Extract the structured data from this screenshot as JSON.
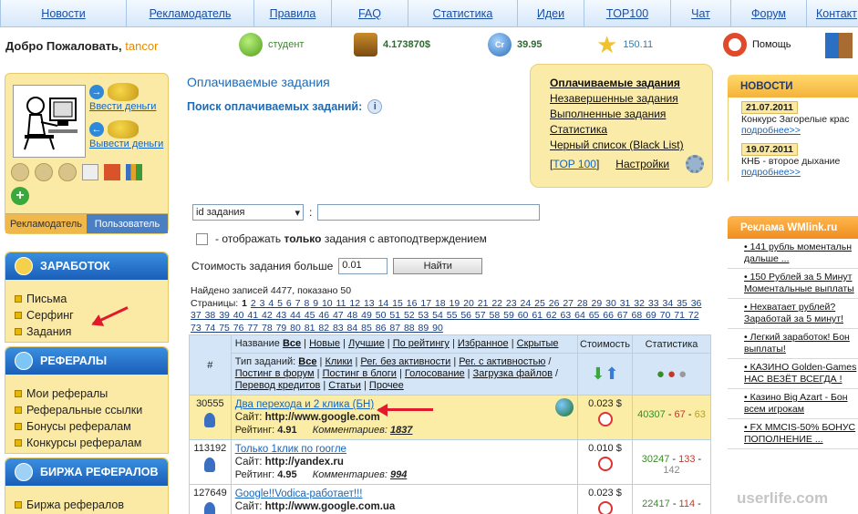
{
  "nav": [
    "Новости",
    "Рекламодатель",
    "Правила",
    "FAQ",
    "Статистика",
    "Идеи",
    "TOP100",
    "Чат",
    "Форум",
    "Контакт"
  ],
  "header": {
    "welcome": "Добро Пожаловать,",
    "username": "tancor",
    "status": "студент",
    "balance": "4.173870$",
    "credits": "39.95",
    "rating": "150.11",
    "help": "Помощь"
  },
  "profile": {
    "deposit": "Ввести деньги",
    "withdraw": "Вывести деньги",
    "tab_advertiser": "Рекламодатель",
    "tab_user": "Пользователь"
  },
  "sidebar": {
    "earn_title": "ЗАРАБОТОК",
    "earn_items": [
      "Письма",
      "Серфинг",
      "Задания"
    ],
    "ref_title": "РЕФЕРАЛЫ",
    "ref_items": [
      "Мои рефералы",
      "Реферальные ссылки",
      "Бонусы рефералам",
      "Конкурсы рефералам"
    ],
    "exchange_title": "БИРЖА РЕФЕРАЛОВ",
    "exchange_items": [
      "Биржа рефералов"
    ]
  },
  "main": {
    "title": "Оплачиваемые задания",
    "search_label": "Поиск оплачиваемых заданий:",
    "links": [
      "Оплачиваемые задания",
      "Незавершенные задания",
      "Выполненные задания",
      "Статистика",
      "Черный список (Black List)"
    ],
    "top100": "TOP 100",
    "top100_open": "[",
    "top100_close": "]",
    "settings": "Настройки",
    "select_value": "id задания",
    "colon": ":",
    "checkbox_prefix": "- отображать",
    "checkbox_bold": "только",
    "checkbox_suffix": "задания с автоподтверждением",
    "price_label": "Стоимость задания больше",
    "price_value": "0.01",
    "find_button": "Найти",
    "found_text": "Найдено записей 4477, показано 50",
    "pages_label": "Страницы:",
    "pages_current": "1",
    "pages": "2 3 4 5 6 7 8 9 10 11 12 13 14 15 16 17 18 19 20 21 22 23 24 25 26 27 28 29 30 31 32 33 34 35 36 37 38 39 40 41 42 43 44 45 46 47 48 49 50 51 52 53 54 55 56 57 58 59 60 61 62 63 64 65 66 67 68 69 70 71 72 73 74 75 76 77 78 79 80 81 82 83 84 85 86 87 88 89 90"
  },
  "table": {
    "hash": "#",
    "name_label": "Название",
    "name_filters": [
      "Все",
      "Новые",
      "Лучшие",
      "По рейтингу",
      "Избранное",
      "Скрытые"
    ],
    "type_label": "Тип заданий:",
    "type_filters": [
      "Все",
      "Клики",
      "Рег. без активности",
      "Рег. с активностью",
      "Постинг в форум",
      "Постинг в блоги",
      "Голосование",
      "Загрузка файлов",
      "Перевод кредитов",
      "Статьи",
      "Прочее"
    ],
    "cost_header": "Стоимость",
    "stats_header": "Статистика",
    "site_label": "Сайт:",
    "rating_label": "Рейтинг:",
    "comments_label": "Комментариев:",
    "rows": [
      {
        "id": "30555",
        "title": "Два перехода и 2 клика (БН)",
        "site": "http://www.google.com",
        "rating": "4.91",
        "comments": "1837",
        "price": "0.023 $",
        "s1": "40307",
        "s2": "67",
        "s3": "63"
      },
      {
        "id": "113192",
        "title": "Только 1клик по гоогле",
        "site": "http://yandex.ru",
        "rating": "4.95",
        "comments": "994",
        "price": "0.010 $",
        "s1": "30247",
        "s2": "133",
        "s3": "142"
      },
      {
        "id": "127649",
        "title": "Google!!Vodica-работает!!!",
        "site": "http://www.google.com.ua",
        "rating": "",
        "comments": "",
        "price": "0.023 $",
        "s1": "22417",
        "s2": "114",
        "s3": ""
      }
    ]
  },
  "right": {
    "news_title": "НОВОСТИ",
    "news": [
      {
        "date": "21.07.2011",
        "text": "Конкурс Загорелые крас",
        "more": "подробнее>>"
      },
      {
        "date": "19.07.2011",
        "text": "КНБ - второе дыхание",
        "more": "подробнее>>"
      }
    ],
    "ads_title": "Реклама WMlink.ru",
    "ads": [
      "• 141 рубль моментальн",
      "дальше ...",
      "• 150 Рублей за 5 Минут",
      "Моментальные выплаты",
      "• Нехватает рублей?",
      "Заработай за 5 минут!",
      "• Легкий заработок! Бон",
      "выплаты!",
      "• КАЗИНО Golden-Games",
      "НАС ВЕЗЁТ ВСЕГДА !",
      "• Казино Big Azart - Бон",
      "всем игрокам",
      "• FX MMCIS-50% БОНУС",
      "ПОПОЛНЕНИЕ ..."
    ]
  },
  "watermark": "userlife.com",
  "colors": {
    "accent": "#1f6ab5",
    "panel": "#fbe9a6",
    "arrow": "#e0192b"
  }
}
